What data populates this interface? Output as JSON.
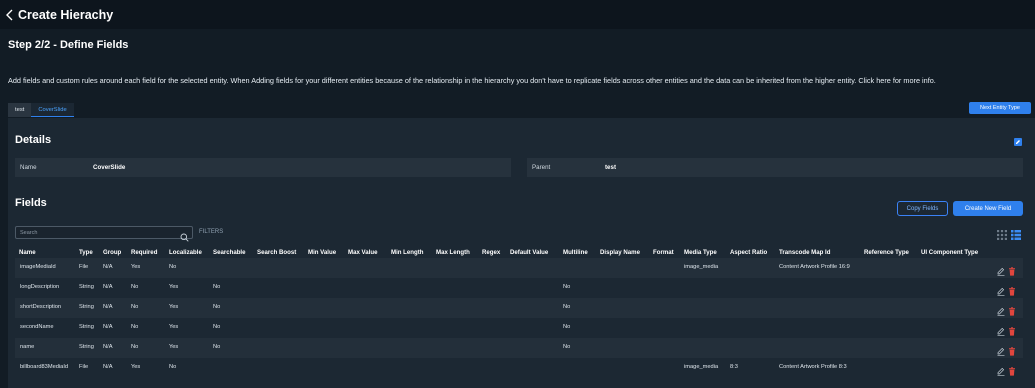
{
  "header": {
    "title": "Create Hierachy"
  },
  "step": {
    "title": "Step 2/2 - Define Fields"
  },
  "description": "Add fields and custom rules around each field for the selected entity. When Adding fields for your different entities because of the relationship in the hierarchy you don't have to replicate fields across other entities and the data can be inherited from the higher entity. Click here for more info.",
  "tabs": [
    {
      "label": "test",
      "active": false
    },
    {
      "label": "CoverSlide",
      "active": true
    }
  ],
  "next_button": "Next Entity Type",
  "details": {
    "title": "Details",
    "name_label": "Name",
    "name_value": "CoverSlide",
    "parent_label": "Parent",
    "parent_value": "test"
  },
  "fields": {
    "title": "Fields",
    "copy_button": "Copy Fields",
    "create_button": "Create New Field",
    "search_placeholder": "Search",
    "filters_label": "FILTERS",
    "columns": [
      "Name",
      "Type",
      "Group",
      "Required",
      "Localizable",
      "Searchable",
      "Search Boost",
      "Min Value",
      "Max Value",
      "Min Length",
      "Max Length",
      "Regex",
      "Default Value",
      "Multiline",
      "Display Name",
      "Format",
      "Media Type",
      "Aspect Ratio",
      "Transcode Map Id",
      "Reference Type",
      "UI Component Type"
    ],
    "rows": [
      {
        "name": "imageMediaId",
        "type": "File",
        "group": "N/A",
        "required": "Yes",
        "localizable": "No",
        "searchable": "",
        "multiline": "",
        "media_type": "image_media",
        "aspect_ratio": "",
        "transcode": "Content Artwork Profile 16:9"
      },
      {
        "name": "longDescription",
        "type": "String",
        "group": "N/A",
        "required": "No",
        "localizable": "Yes",
        "searchable": "No",
        "multiline": "No",
        "media_type": "",
        "aspect_ratio": "",
        "transcode": ""
      },
      {
        "name": "shortDescription",
        "type": "String",
        "group": "N/A",
        "required": "No",
        "localizable": "Yes",
        "searchable": "No",
        "multiline": "No",
        "media_type": "",
        "aspect_ratio": "",
        "transcode": ""
      },
      {
        "name": "secondName",
        "type": "String",
        "group": "N/A",
        "required": "No",
        "localizable": "Yes",
        "searchable": "No",
        "multiline": "No",
        "media_type": "",
        "aspect_ratio": "",
        "transcode": ""
      },
      {
        "name": "name",
        "type": "String",
        "group": "N/A",
        "required": "No",
        "localizable": "Yes",
        "searchable": "No",
        "multiline": "No",
        "media_type": "",
        "aspect_ratio": "",
        "transcode": ""
      },
      {
        "name": "billboard83MediaId",
        "type": "File",
        "group": "N/A",
        "required": "Yes",
        "localizable": "No",
        "searchable": "",
        "multiline": "",
        "media_type": "image_media",
        "aspect_ratio": "8:3",
        "transcode": "Content Artwork Profile 8:3"
      }
    ]
  },
  "colors": {
    "accent": "#2f80ed",
    "delete": "#e0463e",
    "background": "#121c25",
    "panel": "#1c2833"
  },
  "icons": {
    "back": "chevron-left-icon",
    "edit": "pencil-icon",
    "delete": "trash-icon",
    "search": "search-icon",
    "grid_view": "grid-view-icon",
    "list_view": "list-view-icon"
  }
}
